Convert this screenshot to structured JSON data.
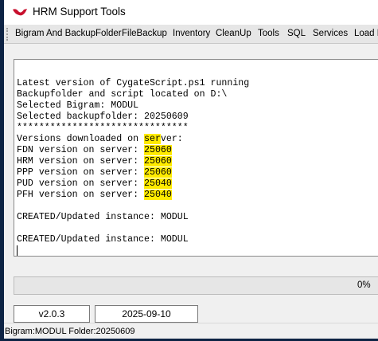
{
  "window": {
    "title": "HRM Support Tools",
    "brand_color": "#c8102e"
  },
  "menu": [
    "Bigram And BackupFolder",
    "FileBackup",
    "Inventory",
    "CleanUp",
    "Tools",
    "SQL",
    "Services",
    "Load L"
  ],
  "log": {
    "lines": [
      "Latest version of CygateScript.ps1 running",
      "Backupfolder and script located on D:\\",
      "Selected Bigram: MODUL",
      "Selected backupfolder: 20250609",
      "*******************************"
    ],
    "versions_header_a": "Versions downloaded on ",
    "versions_header_b": "ser",
    "versions_header_c": "ver:",
    "versions": [
      {
        "label": "FDN version on server: ",
        "value": "25060"
      },
      {
        "label": "HRM version on server: ",
        "value": "25060"
      },
      {
        "label": "PPP version on server: ",
        "value": "25060"
      },
      {
        "label": "PUD version on server: ",
        "value": "25040"
      },
      {
        "label": "PFH version on server: ",
        "value": "25040"
      }
    ],
    "created": [
      "CREATED/Updated instance: MODUL",
      "CREATED/Updated instance: MODUL"
    ],
    "highlight_color": "#ffeb00"
  },
  "progress": {
    "value": 0,
    "label": "0%"
  },
  "version_box": "v2.0.3",
  "date_box": "2025-09-10",
  "status": "Bigram:MODUL Folder:20250609"
}
